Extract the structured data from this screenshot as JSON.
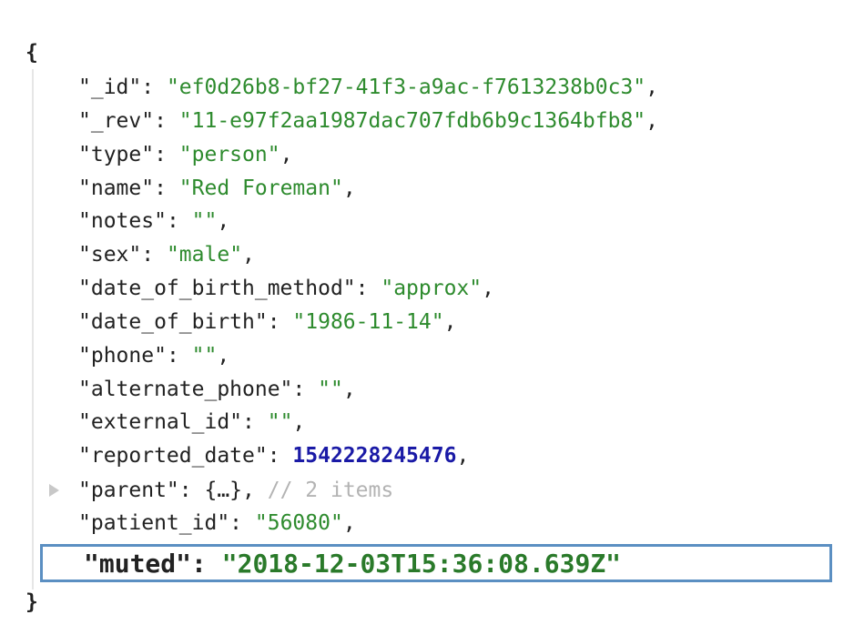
{
  "json_viewer": {
    "open_brace": "{",
    "close_brace": "}",
    "colors": {
      "string": "#2e8b2e",
      "number": "#1a1aa6",
      "comment": "#b3b3b3",
      "highlight_border": "#5b8fc2"
    },
    "entries": [
      {
        "key": "\"_id\"",
        "sep": ": ",
        "value": "\"ef0d26b8-bf27-41f3-a9ac-f7613238b0c3\"",
        "trail": ","
      },
      {
        "key": "\"_rev\"",
        "sep": ": ",
        "value": "\"11-e97f2aa1987dac707fdb6b9c1364bfb8\"",
        "trail": ","
      },
      {
        "key": "\"type\"",
        "sep": ": ",
        "value": "\"person\"",
        "trail": ","
      },
      {
        "key": "\"name\"",
        "sep": ": ",
        "value": "\"Red Foreman\"",
        "trail": ","
      },
      {
        "key": "\"notes\"",
        "sep": ": ",
        "value": "\"\"",
        "trail": ","
      },
      {
        "key": "\"sex\"",
        "sep": ": ",
        "value": "\"male\"",
        "trail": ","
      },
      {
        "key": "\"date_of_birth_method\"",
        "sep": ": ",
        "value": "\"approx\"",
        "trail": ","
      },
      {
        "key": "\"date_of_birth\"",
        "sep": ": ",
        "value": "\"1986-11-14\"",
        "trail": ","
      },
      {
        "key": "\"phone\"",
        "sep": ": ",
        "value": "\"\"",
        "trail": ","
      },
      {
        "key": "\"alternate_phone\"",
        "sep": ": ",
        "value": "\"\"",
        "trail": ","
      },
      {
        "key": "\"external_id\"",
        "sep": ": ",
        "value": "\"\"",
        "trail": ","
      },
      {
        "key": "\"reported_date\"",
        "sep": ": ",
        "value": "1542228245476",
        "trail": ","
      },
      {
        "key": "\"parent\"",
        "sep": ": ",
        "value": "{…}",
        "trail": ",",
        "comment": "// 2 items"
      },
      {
        "key": "\"patient_id\"",
        "sep": ": ",
        "value": "\"56080\"",
        "trail": ","
      },
      {
        "key": "\"muted\"",
        "sep": ": ",
        "value": "\"2018-12-03T15:36:08.639Z\"",
        "trail": ""
      }
    ]
  }
}
